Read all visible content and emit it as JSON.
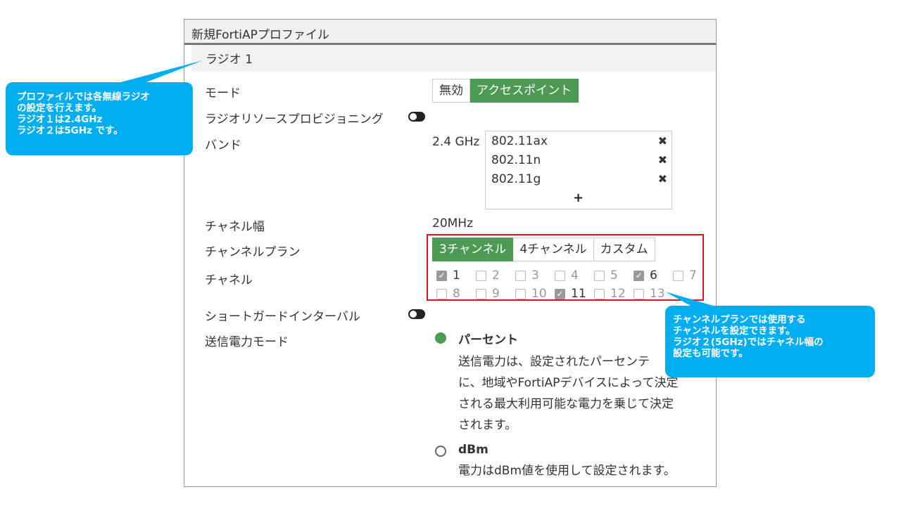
{
  "dialog": {
    "title": "新規FortiAPプロファイル",
    "section": "ラジオ 1"
  },
  "fields": {
    "mode": {
      "label": "モード",
      "options": [
        "無効",
        "アクセスポイント"
      ],
      "selected": "アクセスポイント"
    },
    "radio_resource_provisioning": {
      "label": "ラジオリソースプロビジョニング",
      "enabled": false
    },
    "band": {
      "label": "バンド",
      "value": "2.4 GHz",
      "items": [
        "802.11ax",
        "802.11n",
        "802.11g"
      ],
      "remove_icon": "close-icon",
      "add_icon": "plus-icon",
      "add_label": "+"
    },
    "channel_width": {
      "label": "チャネル幅",
      "value": "20MHz"
    },
    "channel_plan": {
      "label": "チャンネルプラン",
      "options": [
        "3チャンネル",
        "4チャンネル",
        "カスタム"
      ],
      "selected": "3チャンネル"
    },
    "channels": {
      "label": "チャネル",
      "items": [
        {
          "num": "1",
          "checked": true
        },
        {
          "num": "2",
          "checked": false
        },
        {
          "num": "3",
          "checked": false
        },
        {
          "num": "4",
          "checked": false
        },
        {
          "num": "5",
          "checked": false
        },
        {
          "num": "6",
          "checked": true
        },
        {
          "num": "7",
          "checked": false
        },
        {
          "num": "8",
          "checked": false
        },
        {
          "num": "9",
          "checked": false
        },
        {
          "num": "10",
          "checked": false
        },
        {
          "num": "11",
          "checked": true
        },
        {
          "num": "12",
          "checked": false
        },
        {
          "num": "13",
          "checked": false
        }
      ]
    },
    "short_guard_interval": {
      "label": "ショートガードインターバル",
      "enabled": false
    },
    "tx_power_mode": {
      "label": "送信電力モード",
      "options": [
        {
          "title": "パーセント",
          "selected": true,
          "desc": [
            "送信電力は、設定されたパーセンテ",
            "に、地域やFortiAPデバイスによって決定",
            "される最大利用可能な電力を乗じて決定",
            "されます。"
          ]
        },
        {
          "title": "dBm",
          "selected": false,
          "desc": [
            "電力はdBm値を使用して設定されます。"
          ]
        }
      ]
    }
  },
  "callouts": {
    "left": [
      "プロファイルでは各無線ラジオ",
      "の設定を行えます。",
      "ラジオ１は2.4GHz",
      "ラジオ２は5GHz です。"
    ],
    "right": [
      "チャンネルプランでは使用する",
      "チャンネルを設定できます。",
      "ラジオ２(5GHz)ではチャネル幅の",
      "設定も可能です。"
    ]
  },
  "colors": {
    "accent_green": "#4d9a55",
    "callout_blue": "#00aeef",
    "highlight_red": "#e0141e"
  }
}
